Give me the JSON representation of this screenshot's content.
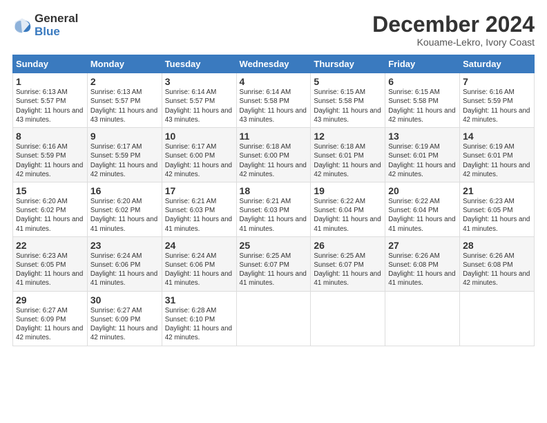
{
  "logo": {
    "general": "General",
    "blue": "Blue"
  },
  "title": "December 2024",
  "subtitle": "Kouame-Lekro, Ivory Coast",
  "days_of_week": [
    "Sunday",
    "Monday",
    "Tuesday",
    "Wednesday",
    "Thursday",
    "Friday",
    "Saturday"
  ],
  "weeks": [
    [
      {
        "day": "1",
        "sunrise": "6:13 AM",
        "sunset": "5:57 PM",
        "daylight": "11 hours and 43 minutes."
      },
      {
        "day": "2",
        "sunrise": "6:13 AM",
        "sunset": "5:57 PM",
        "daylight": "11 hours and 43 minutes."
      },
      {
        "day": "3",
        "sunrise": "6:14 AM",
        "sunset": "5:57 PM",
        "daylight": "11 hours and 43 minutes."
      },
      {
        "day": "4",
        "sunrise": "6:14 AM",
        "sunset": "5:58 PM",
        "daylight": "11 hours and 43 minutes."
      },
      {
        "day": "5",
        "sunrise": "6:15 AM",
        "sunset": "5:58 PM",
        "daylight": "11 hours and 43 minutes."
      },
      {
        "day": "6",
        "sunrise": "6:15 AM",
        "sunset": "5:58 PM",
        "daylight": "11 hours and 42 minutes."
      },
      {
        "day": "7",
        "sunrise": "6:16 AM",
        "sunset": "5:59 PM",
        "daylight": "11 hours and 42 minutes."
      }
    ],
    [
      {
        "day": "8",
        "sunrise": "6:16 AM",
        "sunset": "5:59 PM",
        "daylight": "11 hours and 42 minutes."
      },
      {
        "day": "9",
        "sunrise": "6:17 AM",
        "sunset": "5:59 PM",
        "daylight": "11 hours and 42 minutes."
      },
      {
        "day": "10",
        "sunrise": "6:17 AM",
        "sunset": "6:00 PM",
        "daylight": "11 hours and 42 minutes."
      },
      {
        "day": "11",
        "sunrise": "6:18 AM",
        "sunset": "6:00 PM",
        "daylight": "11 hours and 42 minutes."
      },
      {
        "day": "12",
        "sunrise": "6:18 AM",
        "sunset": "6:01 PM",
        "daylight": "11 hours and 42 minutes."
      },
      {
        "day": "13",
        "sunrise": "6:19 AM",
        "sunset": "6:01 PM",
        "daylight": "11 hours and 42 minutes."
      },
      {
        "day": "14",
        "sunrise": "6:19 AM",
        "sunset": "6:01 PM",
        "daylight": "11 hours and 42 minutes."
      }
    ],
    [
      {
        "day": "15",
        "sunrise": "6:20 AM",
        "sunset": "6:02 PM",
        "daylight": "11 hours and 41 minutes."
      },
      {
        "day": "16",
        "sunrise": "6:20 AM",
        "sunset": "6:02 PM",
        "daylight": "11 hours and 41 minutes."
      },
      {
        "day": "17",
        "sunrise": "6:21 AM",
        "sunset": "6:03 PM",
        "daylight": "11 hours and 41 minutes."
      },
      {
        "day": "18",
        "sunrise": "6:21 AM",
        "sunset": "6:03 PM",
        "daylight": "11 hours and 41 minutes."
      },
      {
        "day": "19",
        "sunrise": "6:22 AM",
        "sunset": "6:04 PM",
        "daylight": "11 hours and 41 minutes."
      },
      {
        "day": "20",
        "sunrise": "6:22 AM",
        "sunset": "6:04 PM",
        "daylight": "11 hours and 41 minutes."
      },
      {
        "day": "21",
        "sunrise": "6:23 AM",
        "sunset": "6:05 PM",
        "daylight": "11 hours and 41 minutes."
      }
    ],
    [
      {
        "day": "22",
        "sunrise": "6:23 AM",
        "sunset": "6:05 PM",
        "daylight": "11 hours and 41 minutes."
      },
      {
        "day": "23",
        "sunrise": "6:24 AM",
        "sunset": "6:06 PM",
        "daylight": "11 hours and 41 minutes."
      },
      {
        "day": "24",
        "sunrise": "6:24 AM",
        "sunset": "6:06 PM",
        "daylight": "11 hours and 41 minutes."
      },
      {
        "day": "25",
        "sunrise": "6:25 AM",
        "sunset": "6:07 PM",
        "daylight": "11 hours and 41 minutes."
      },
      {
        "day": "26",
        "sunrise": "6:25 AM",
        "sunset": "6:07 PM",
        "daylight": "11 hours and 41 minutes."
      },
      {
        "day": "27",
        "sunrise": "6:26 AM",
        "sunset": "6:08 PM",
        "daylight": "11 hours and 41 minutes."
      },
      {
        "day": "28",
        "sunrise": "6:26 AM",
        "sunset": "6:08 PM",
        "daylight": "11 hours and 42 minutes."
      }
    ],
    [
      {
        "day": "29",
        "sunrise": "6:27 AM",
        "sunset": "6:09 PM",
        "daylight": "11 hours and 42 minutes."
      },
      {
        "day": "30",
        "sunrise": "6:27 AM",
        "sunset": "6:09 PM",
        "daylight": "11 hours and 42 minutes."
      },
      {
        "day": "31",
        "sunrise": "6:28 AM",
        "sunset": "6:10 PM",
        "daylight": "11 hours and 42 minutes."
      },
      null,
      null,
      null,
      null
    ]
  ]
}
